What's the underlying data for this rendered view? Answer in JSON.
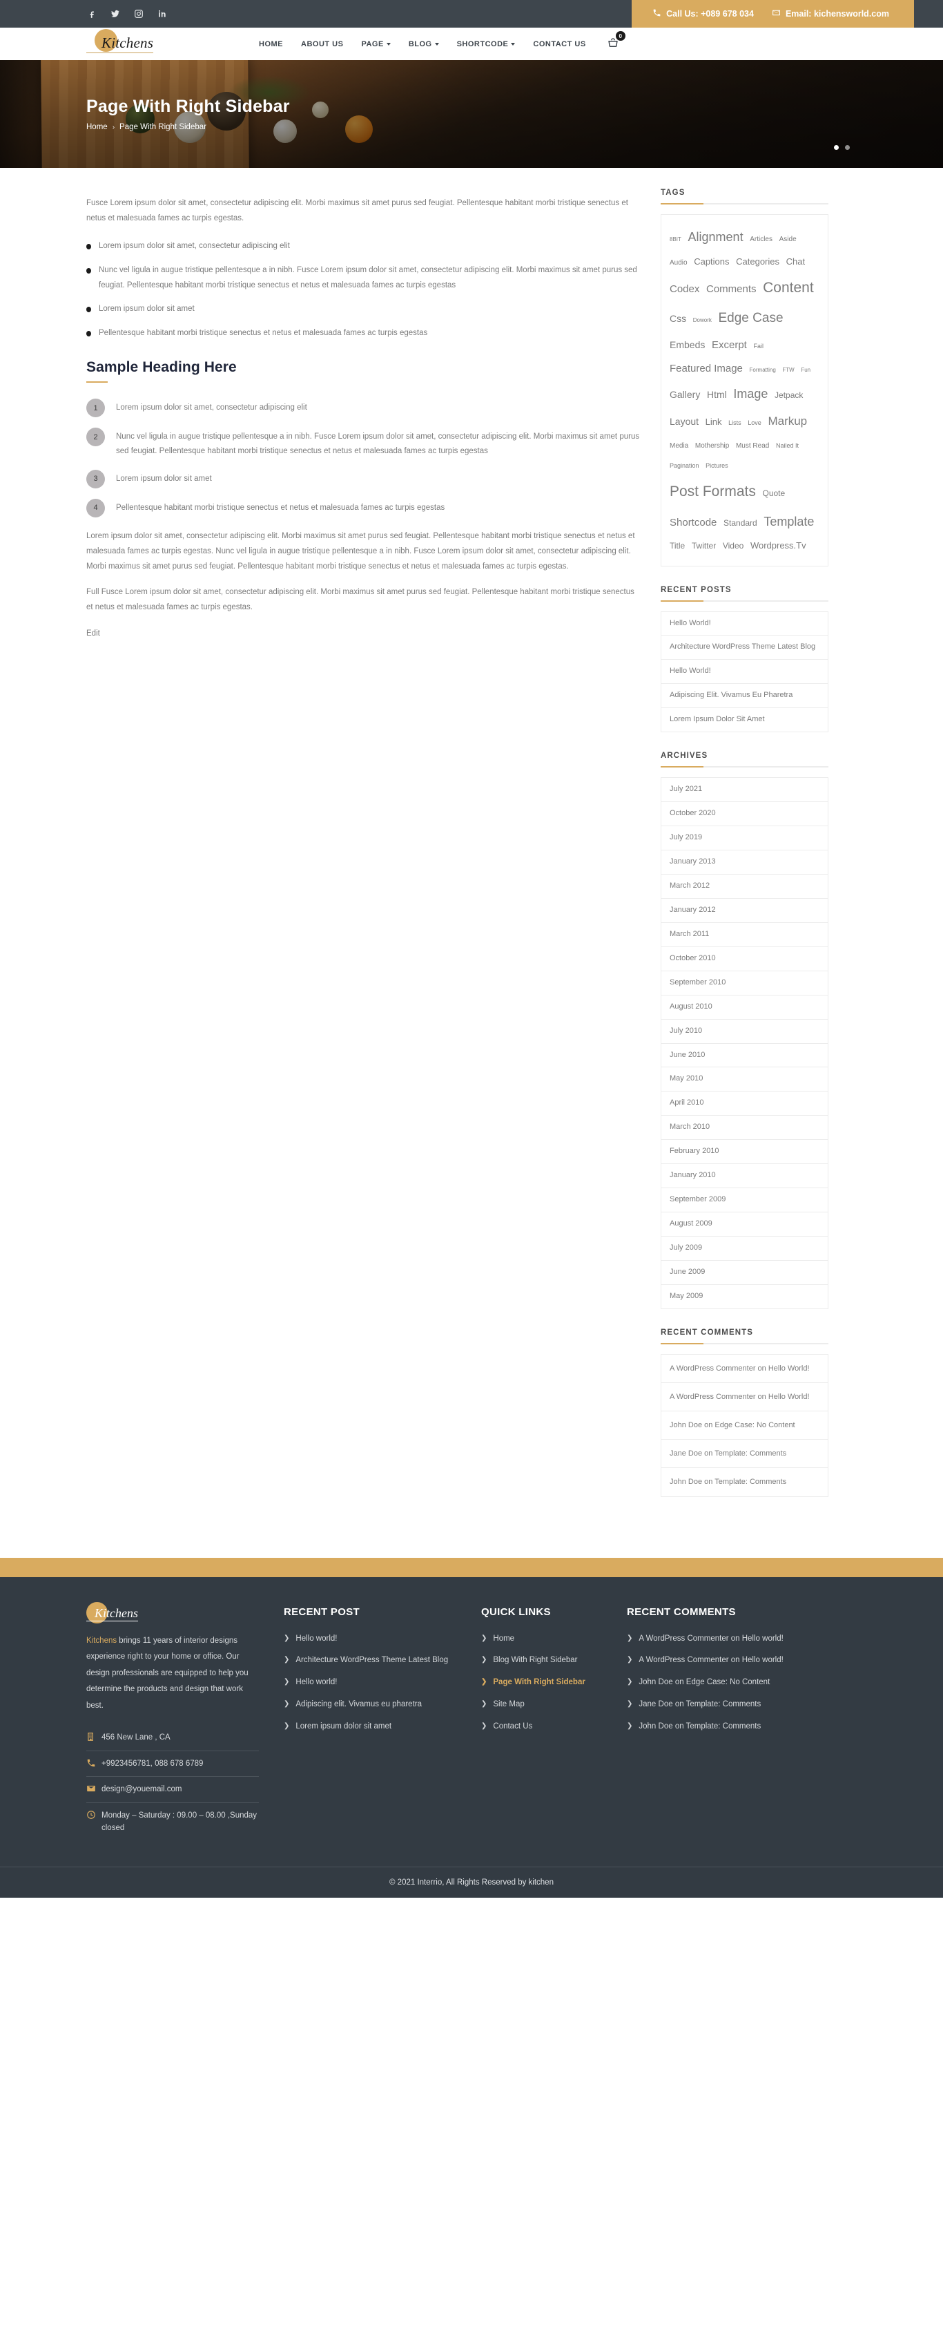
{
  "topbar": {
    "social": [
      {
        "name": "facebook-icon",
        "label": "Facebook"
      },
      {
        "name": "twitter-icon",
        "label": "Twitter"
      },
      {
        "name": "instagram-icon",
        "label": "Instagram"
      },
      {
        "name": "linkedin-icon",
        "label": "LinkedIn"
      }
    ],
    "phone": "Call Us: +089 678 034",
    "email": "Email: kichensworld.com",
    "accent": "#d9ab5f",
    "bg": "#3e464d"
  },
  "header": {
    "logo": "Kitchens",
    "nav": [
      {
        "label": "HOME",
        "caret": false
      },
      {
        "label": "ABOUT US",
        "caret": false
      },
      {
        "label": "PAGE",
        "caret": true
      },
      {
        "label": "BLOG",
        "caret": true
      },
      {
        "label": "SHORTCODE",
        "caret": true
      },
      {
        "label": "CONTACT US",
        "caret": false
      }
    ],
    "cart_count": "0"
  },
  "hero": {
    "title": "Page With Right Sidebar",
    "breadcrumb_home": "Home",
    "breadcrumb_sep": "›",
    "breadcrumb_current": "Page With Right Sidebar"
  },
  "content": {
    "intro": "Fusce Lorem ipsum dolor sit amet, consectetur adipiscing elit. Morbi maximus sit amet purus sed feugiat. Pellentesque habitant morbi tristique senectus et netus et malesuada fames ac turpis egestas.",
    "bullets": [
      "Lorem ipsum dolor sit amet, consectetur adipiscing elit",
      "Nunc vel ligula in augue tristique pellentesque a in nibh. Fusce Lorem ipsum dolor sit amet, consectetur adipiscing elit. Morbi maximus sit amet purus sed feugiat. Pellentesque habitant morbi tristique senectus et netus et malesuada fames ac turpis egestas",
      "Lorem ipsum dolor sit amet",
      "Pellentesque habitant morbi tristique senectus et netus et malesuada fames ac turpis egestas"
    ],
    "heading": "Sample Heading Here",
    "numbered": [
      {
        "n": "1",
        "text": "Lorem ipsum dolor sit amet, consectetur adipiscing elit"
      },
      {
        "n": "2",
        "text": "Nunc vel ligula in augue tristique pellentesque a in nibh. Fusce Lorem ipsum dolor sit amet, consectetur adipiscing elit. Morbi maximus sit amet purus sed feugiat. Pellentesque habitant morbi tristique senectus et netus et malesuada fames ac turpis egestas"
      },
      {
        "n": "3",
        "text": "Lorem ipsum dolor sit amet"
      },
      {
        "n": "4",
        "text": "Pellentesque habitant morbi tristique senectus et netus et malesuada fames ac turpis egestas"
      }
    ],
    "para_1": "Lorem ipsum dolor sit amet, consectetur adipiscing elit. Morbi maximus sit amet purus sed feugiat. Pellentesque habitant morbi tristique senectus et netus et malesuada fames ac turpis egestas. Nunc vel ligula in augue tristique pellentesque a in nibh. Fusce Lorem ipsum dolor sit amet, consectetur adipiscing elit. Morbi maximus sit amet purus sed feugiat. Pellentesque habitant morbi tristique senectus et netus et malesuada fames ac turpis egestas.",
    "para_2": "Full Fusce Lorem ipsum dolor sit amet, consectetur adipiscing elit. Morbi maximus sit amet purus sed feugiat. Pellentesque habitant morbi tristique senectus et netus et malesuada fames ac turpis egestas.",
    "edit": "Edit"
  },
  "sidebar": {
    "tags_title": "TAGS",
    "tags": [
      {
        "label": "8BIT",
        "size": 8
      },
      {
        "label": "Alignment",
        "size": 18
      },
      {
        "label": "Articles",
        "size": 10
      },
      {
        "label": "Aside",
        "size": 10
      },
      {
        "label": "Audio",
        "size": 10
      },
      {
        "label": "Captions",
        "size": 13
      },
      {
        "label": "Categories",
        "size": 13
      },
      {
        "label": "Chat",
        "size": 13
      },
      {
        "label": "Codex",
        "size": 15
      },
      {
        "label": "Comments",
        "size": 15
      },
      {
        "label": "Content",
        "size": 21
      },
      {
        "label": "Css",
        "size": 14
      },
      {
        "label": "Dowork",
        "size": 8
      },
      {
        "label": "Edge Case",
        "size": 19
      },
      {
        "label": "Embeds",
        "size": 14
      },
      {
        "label": "Excerpt",
        "size": 15
      },
      {
        "label": "Fail",
        "size": 9
      },
      {
        "label": "Featured Image",
        "size": 15
      },
      {
        "label": "Formatting",
        "size": 8
      },
      {
        "label": "FTW",
        "size": 8
      },
      {
        "label": "Fun",
        "size": 8
      },
      {
        "label": "Gallery",
        "size": 14
      },
      {
        "label": "Html",
        "size": 14
      },
      {
        "label": "Image",
        "size": 18
      },
      {
        "label": "Jetpack",
        "size": 12
      },
      {
        "label": "Layout",
        "size": 14
      },
      {
        "label": "Link",
        "size": 13
      },
      {
        "label": "Lists",
        "size": 9
      },
      {
        "label": "Love",
        "size": 9
      },
      {
        "label": "Markup",
        "size": 17
      },
      {
        "label": "Media",
        "size": 10
      },
      {
        "label": "Mothership",
        "size": 10
      },
      {
        "label": "Must Read",
        "size": 10
      },
      {
        "label": "Nailed It",
        "size": 9
      },
      {
        "label": "Pagination",
        "size": 9
      },
      {
        "label": "Pictures",
        "size": 9
      },
      {
        "label": "Post Formats",
        "size": 21
      },
      {
        "label": "Quote",
        "size": 12
      },
      {
        "label": "Shortcode",
        "size": 15
      },
      {
        "label": "Standard",
        "size": 12
      },
      {
        "label": "Template",
        "size": 18
      },
      {
        "label": "Title",
        "size": 12
      },
      {
        "label": "Twitter",
        "size": 12
      },
      {
        "label": "Video",
        "size": 12
      },
      {
        "label": "Wordpress.Tv",
        "size": 13
      }
    ],
    "recent_posts_title": "RECENT POSTS",
    "recent_posts": [
      "Hello World!",
      "Architecture WordPress Theme Latest Blog",
      "Hello World!",
      "Adipiscing Elit. Vivamus Eu Pharetra",
      "Lorem Ipsum Dolor Sit Amet"
    ],
    "archives_title": "ARCHIVES",
    "archives": [
      "July 2021",
      "October 2020",
      "July 2019",
      "January 2013",
      "March 2012",
      "January 2012",
      "March 2011",
      "October 2010",
      "September 2010",
      "August 2010",
      "July 2010",
      "June 2010",
      "May 2010",
      "April 2010",
      "March 2010",
      "February 2010",
      "January 2010",
      "September 2009",
      "August 2009",
      "July 2009",
      "June 2009",
      "May 2009"
    ],
    "recent_comments_title": "RECENT COMMENTS",
    "recent_comments": [
      "A WordPress Commenter on Hello World!",
      "A WordPress Commenter on Hello World!",
      "John Doe on Edge Case: No Content",
      "Jane Doe on Template: Comments",
      "John Doe on Template: Comments"
    ]
  },
  "footer": {
    "logo": "Kitchens",
    "about_brand": "Kitchens",
    "about_rest": " brings 11 years of interior designs experience right to your home or office. Our design professionals are equipped to help you determine the products and design that work best.",
    "info": [
      {
        "icon": "building-icon",
        "text": "456 New Lane , CA"
      },
      {
        "icon": "phone-icon",
        "text": "+9923456781, 088 678 6789"
      },
      {
        "icon": "envelope-icon",
        "text": "design@youemail.com"
      },
      {
        "icon": "clock-icon",
        "text": "Monday – Saturday : 09.00 – 08.00 ,Sunday closed"
      }
    ],
    "recent_post_title": "RECENT POST",
    "recent_posts": [
      "Hello world!",
      "Architecture WordPress Theme Latest Blog",
      "Hello world!",
      "Adipiscing elit. Vivamus eu pharetra",
      "Lorem ipsum dolor sit amet"
    ],
    "quick_links_title": "QUICK LINKS",
    "quick_links": [
      {
        "label": "Home",
        "active": false
      },
      {
        "label": "Blog With Right Sidebar",
        "active": false
      },
      {
        "label": "Page With Right Sidebar",
        "active": true
      },
      {
        "label": "Site Map",
        "active": false
      },
      {
        "label": "Contact Us",
        "active": false
      }
    ],
    "recent_comments_title": "RECENT COMMENTS",
    "recent_comments": [
      "A WordPress Commenter on Hello world!",
      "A WordPress Commenter on Hello world!",
      "John Doe on Edge Case: No Content",
      "Jane Doe on Template: Comments",
      "John Doe on Template: Comments"
    ],
    "copyright": "© 2021 Interrio, All Rights Reserved by kitchen"
  }
}
